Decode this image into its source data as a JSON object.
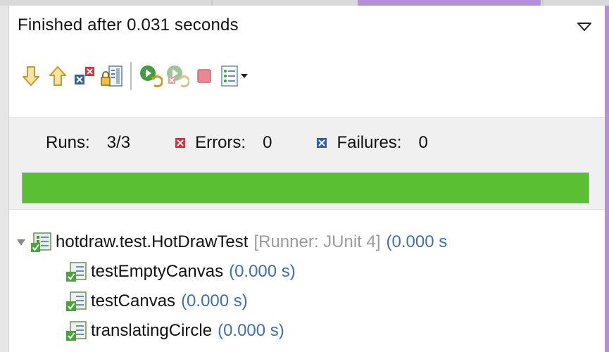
{
  "status": {
    "message": "Finished after 0.031 seconds"
  },
  "toolbar": {
    "buttons": [
      {
        "name": "next-failure",
        "icon": "arrow-down-icon"
      },
      {
        "name": "previous-failure",
        "icon": "arrow-up-icon"
      },
      {
        "name": "show-failures-only",
        "icon": "failures-only-icon"
      },
      {
        "name": "scroll-lock",
        "icon": "scroll-lock-icon"
      },
      {
        "name": "rerun-test",
        "icon": "rerun-icon"
      },
      {
        "name": "rerun-failed-first",
        "icon": "rerun-failed-icon"
      },
      {
        "name": "stop",
        "icon": "stop-icon"
      },
      {
        "name": "test-run-history",
        "icon": "history-icon"
      }
    ]
  },
  "counters": {
    "runs_label": "Runs:",
    "runs_value": "3/3",
    "errors_label": "Errors:",
    "errors_value": "0",
    "failures_label": "Failures:",
    "failures_value": "0"
  },
  "progress": {
    "fraction": 1.0,
    "color": "#5bbf34"
  },
  "tree": {
    "root": {
      "name": "hotdraw.test.HotDrawTest",
      "runner": "[Runner: JUnit 4]",
      "time": "(0.000 s"
    },
    "children": [
      {
        "name": "testEmptyCanvas",
        "time": "(0.000 s)"
      },
      {
        "name": "testCanvas",
        "time": "(0.000 s)"
      },
      {
        "name": "translatingCircle",
        "time": "(0.000 s)"
      }
    ]
  },
  "colors": {
    "accent_purple": "#b78fd6",
    "error_red": "#d9313a",
    "failure_blue": "#2f5fa8",
    "time_blue": "#3e6fb0",
    "runner_gray": "#9a9a9a",
    "success_green": "#5bbf34"
  }
}
